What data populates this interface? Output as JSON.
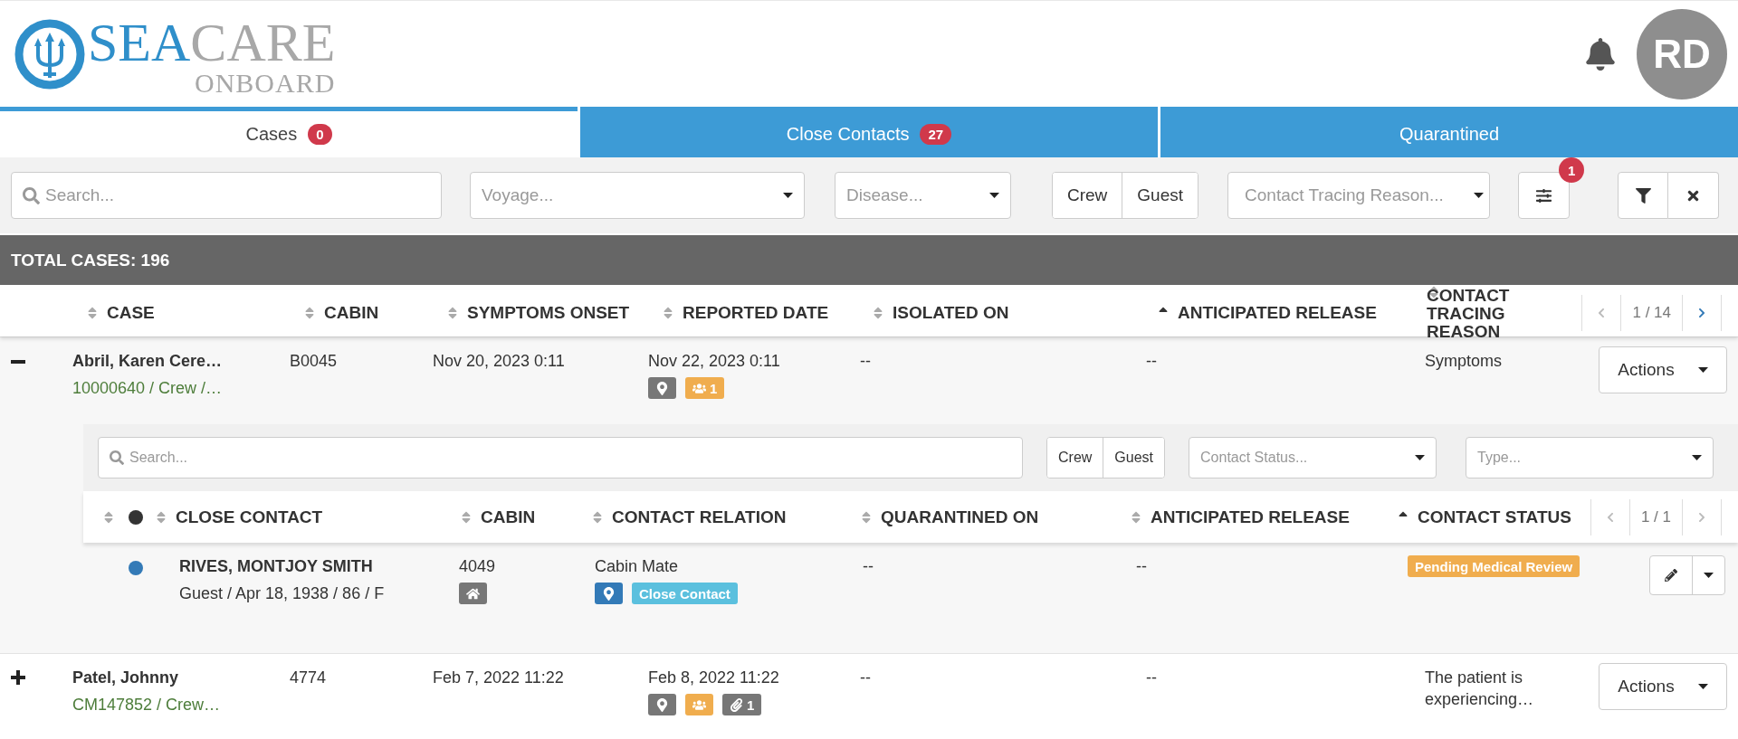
{
  "header": {
    "logo": {
      "part_1": "SEA",
      "part_2": "CARE",
      "part_3": "ONBOARD"
    },
    "avatar": "RD"
  },
  "tabs": [
    {
      "label": "Cases",
      "count": "0",
      "selected": true
    },
    {
      "label": "Close Contacts",
      "count": "27",
      "selected": false
    },
    {
      "label": "Quarantined",
      "selected": false
    }
  ],
  "filters": {
    "search": {
      "placeholder": "Search..."
    },
    "voyage": {
      "placeholder": "Voyage..."
    },
    "disease": {
      "placeholder": "Disease..."
    },
    "person_type": [
      {
        "label": "Crew",
        "selected": false
      },
      {
        "label": "Guest",
        "selected": false
      }
    ],
    "contact_tracing_reason": {
      "placeholder": "Contact Tracing Reason..."
    },
    "settings_badge": "1"
  },
  "total": "TOTAL CASES: 196",
  "table": {
    "columns": [
      {
        "label": "CASE",
        "sorted_ascending": false
      },
      {
        "label": "CABIN",
        "sorted_ascending": false
      },
      {
        "label": "SYMPTOMS ONSET",
        "sorted_ascending": false
      },
      {
        "label": "REPORTED DATE",
        "sorted_ascending": false
      },
      {
        "label": "ISOLATED ON",
        "sorted_ascending": false
      },
      {
        "label": "ANTICIPATED RELEASE",
        "sorted_ascending": true
      },
      {
        "label": "CONTACT TRACING REASON",
        "sorted_ascending": false
      }
    ],
    "pager": {
      "text": "1 / 14",
      "prev_enabled": false,
      "next_enabled": true
    },
    "rows": [
      {
        "expanded": true,
        "name": "Abril, Karen Cere…",
        "subtitle": "10000640 / Crew /…",
        "cabin": "B0045",
        "symptoms_onset": "Nov 20, 2023 0:11",
        "reported_date": "Nov 22, 2023 0:11",
        "badges": [
          {
            "kind": "location",
            "color": "#777777"
          },
          {
            "kind": "group",
            "color": "#f0ad4e",
            "count": "1"
          }
        ],
        "isolated_on": "--",
        "anticipated_release": "--",
        "contact_tracing_reason": "Symptoms",
        "action": "Actions",
        "contacts": {
          "search": {
            "placeholder": "Search..."
          },
          "person_type": [
            {
              "label": "Crew",
              "selected": false
            },
            {
              "label": "Guest",
              "selected": false
            }
          ],
          "contact_status": {
            "placeholder": "Contact Status..."
          },
          "type": {
            "placeholder": "Type..."
          },
          "columns": [
            {
              "label": "CLOSE CONTACT",
              "sorted_ascending": false
            },
            {
              "label": "CABIN",
              "sorted_ascending": false
            },
            {
              "label": "CONTACT RELATION",
              "sorted_ascending": false
            },
            {
              "label": "QUARANTINED ON",
              "sorted_ascending": false
            },
            {
              "label": "ANTICIPATED RELEASE",
              "sorted_ascending": false
            },
            {
              "label": "CONTACT STATUS",
              "sorted_ascending": true
            }
          ],
          "pager": {
            "text": "1 / 1",
            "prev_enabled": false,
            "next_enabled": false
          },
          "rows": [
            {
              "color": "#337ab7",
              "name": "RIVES, MONTJOY SMITH",
              "details": "Guest / Apr 18, 1938 / 86 / F",
              "cabin": "4049",
              "cabin_badges": [
                {
                  "kind": "home",
                  "color": "#777777"
                }
              ],
              "relation": "Cabin Mate",
              "relation_badges": [
                {
                  "kind": "location",
                  "color": "#337ab7"
                },
                {
                  "kind": "label",
                  "text": "Close Contact",
                  "color": "#5bc0de"
                }
              ],
              "quarantined_on": "--",
              "anticipated_release": "--",
              "status": {
                "text": "Pending Medical Review",
                "color": "#f0ad4e"
              }
            }
          ]
        }
      },
      {
        "expanded": false,
        "name": "Patel, Johnny",
        "subtitle": "CM147852 / Crew…",
        "cabin": "4774",
        "symptoms_onset": "Feb 7, 2022 11:22",
        "reported_date": "Feb 8, 2022 11:22",
        "badges": [
          {
            "kind": "location",
            "color": "#777777"
          },
          {
            "kind": "group",
            "color": "#f0ad4e"
          },
          {
            "kind": "attachment",
            "color": "#777777",
            "count": "1"
          }
        ],
        "isolated_on": "--",
        "anticipated_release": "--",
        "contact_tracing_reason": "The patient is experiencing…",
        "action": "Actions"
      }
    ]
  }
}
